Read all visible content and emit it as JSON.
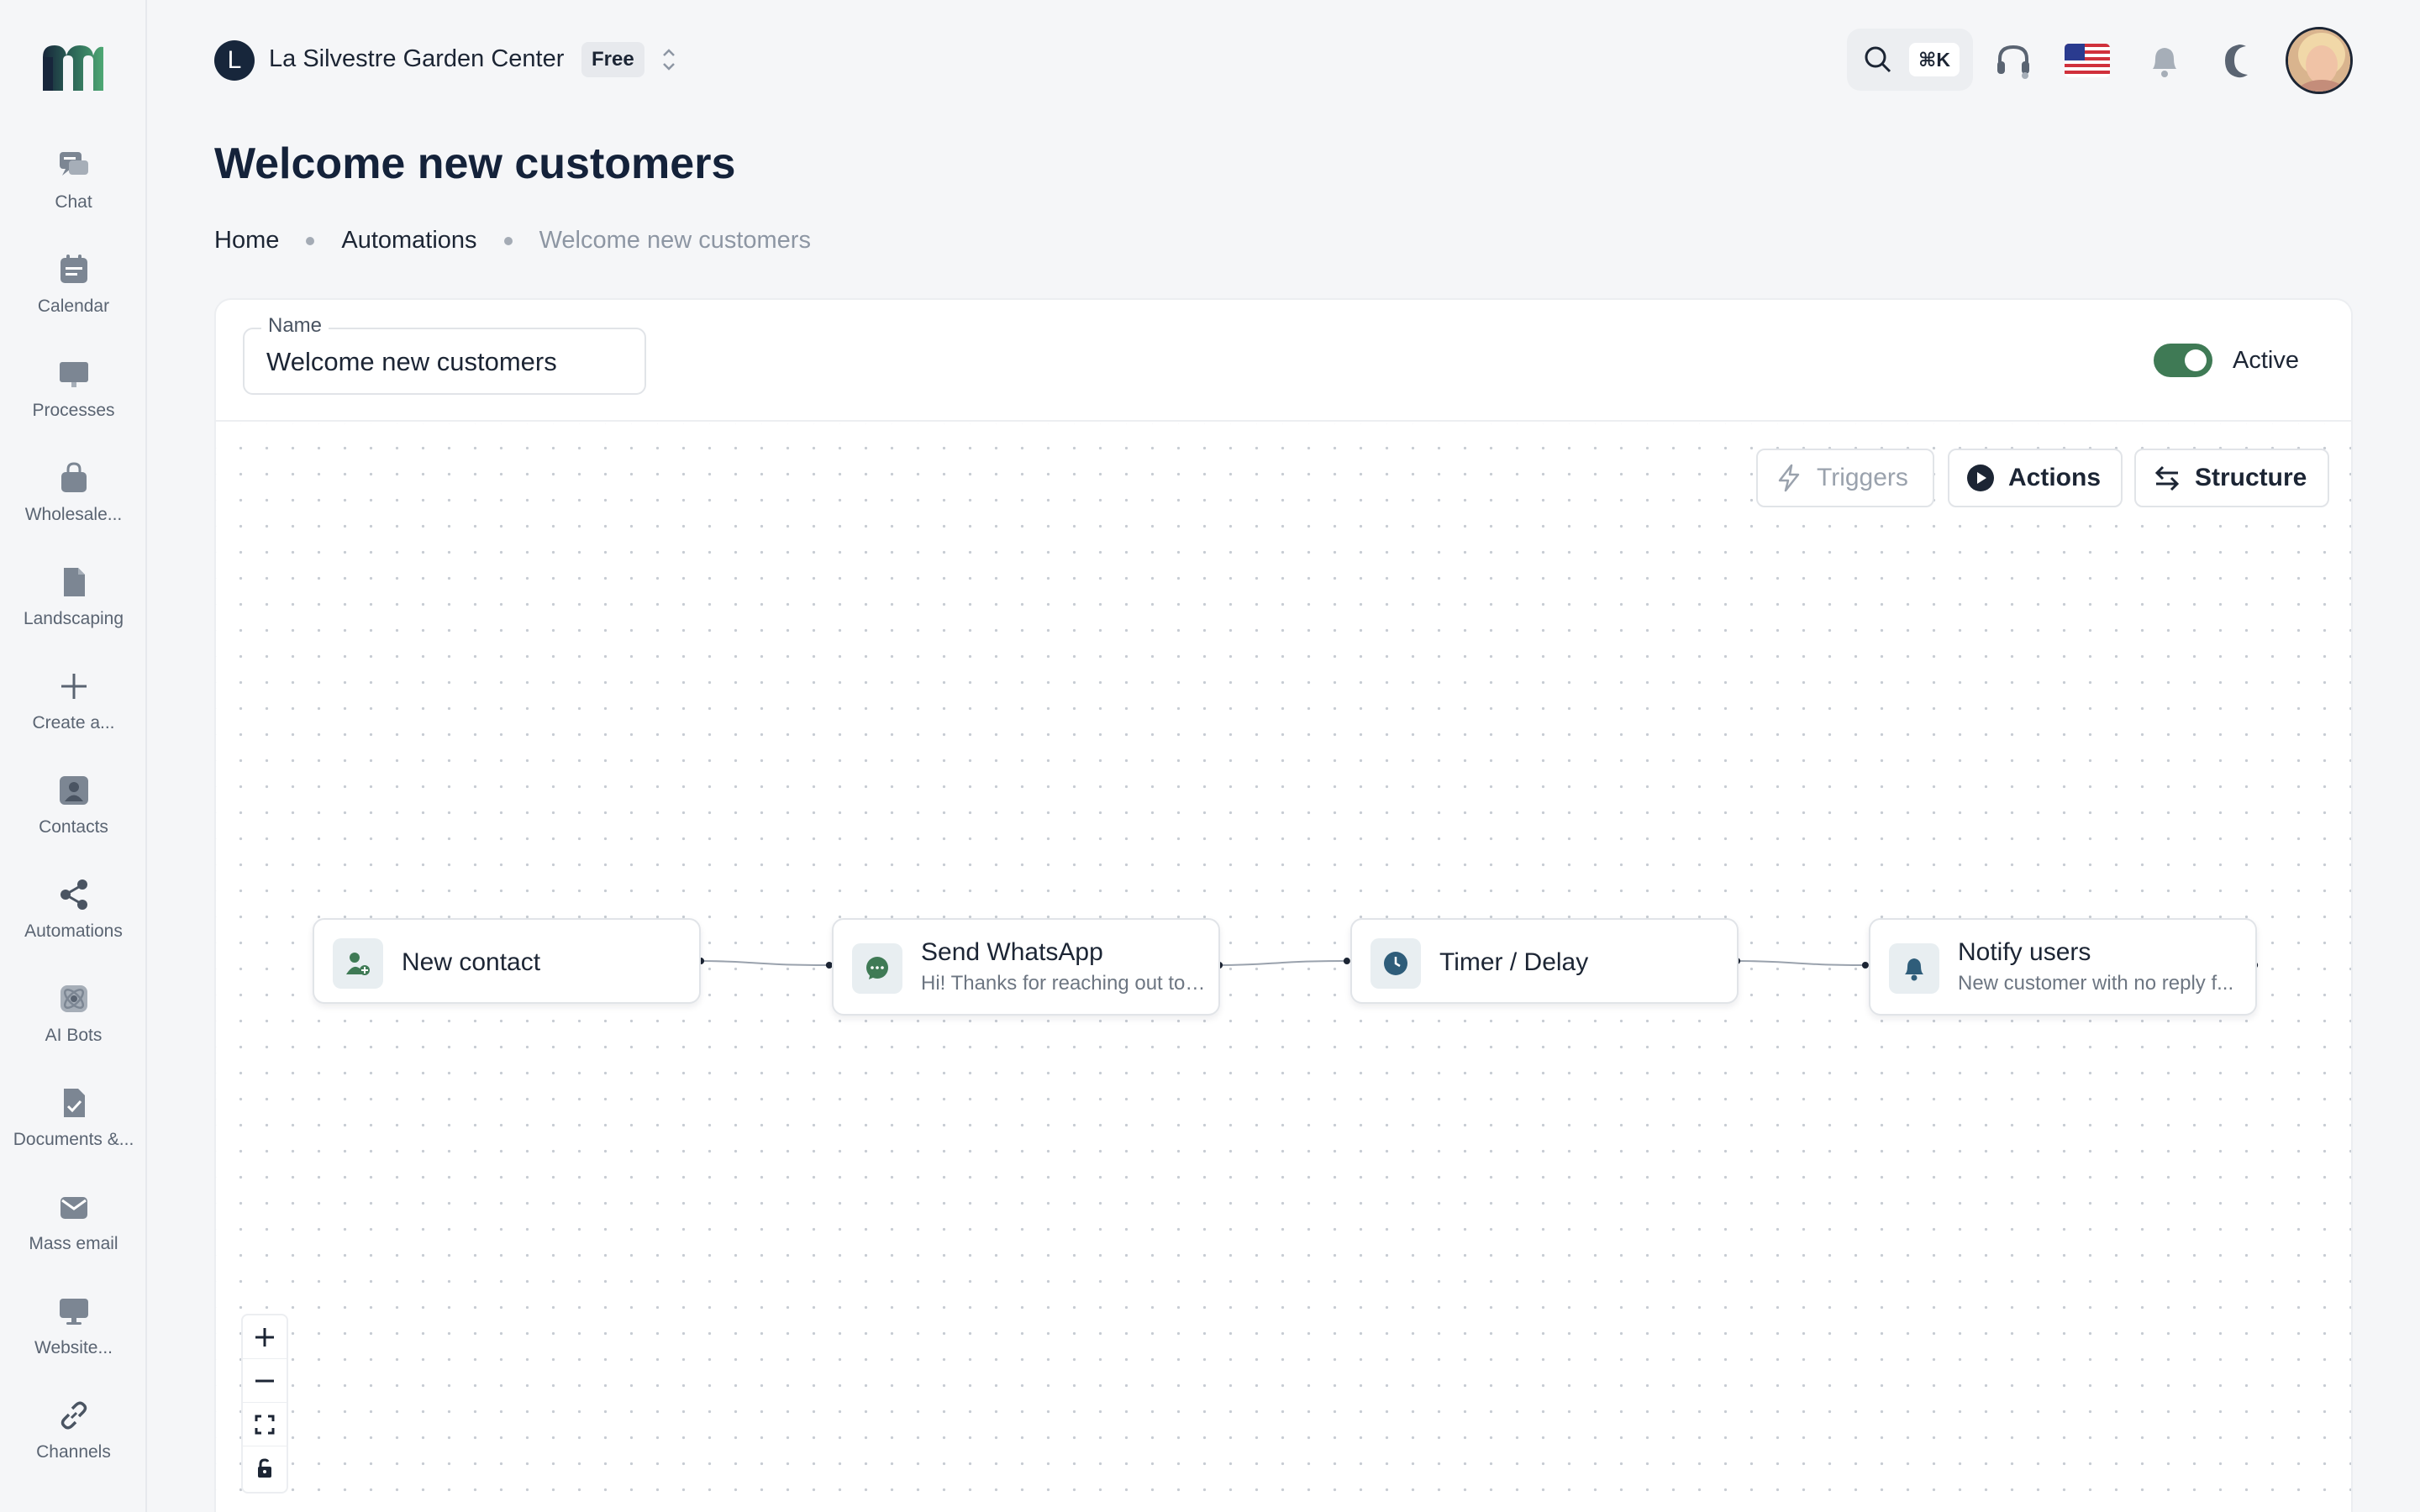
{
  "sidebar": {
    "items": [
      {
        "label": "Chat",
        "icon": "chat-icon"
      },
      {
        "label": "Calendar",
        "icon": "calendar-icon"
      },
      {
        "label": "Processes",
        "icon": "board-icon"
      },
      {
        "label": "Wholesale...",
        "icon": "shopping-bag-icon"
      },
      {
        "label": "Landscaping",
        "icon": "file-icon"
      },
      {
        "label": "Create a...",
        "icon": "plus-icon"
      },
      {
        "label": "Contacts",
        "icon": "contact-icon"
      },
      {
        "label": "Automations",
        "icon": "share-nodes-icon"
      },
      {
        "label": "AI Bots",
        "icon": "atom-icon"
      },
      {
        "label": "Documents &...",
        "icon": "document-check-icon"
      },
      {
        "label": "Mass email",
        "icon": "mail-icon"
      },
      {
        "label": "Website...",
        "icon": "monitor-icon"
      },
      {
        "label": "Channels",
        "icon": "link-icon"
      }
    ]
  },
  "header": {
    "org_initial": "L",
    "org_name": "La Silvestre Garden Center",
    "plan": "Free",
    "shortcut": "⌘K"
  },
  "page": {
    "title": "Welcome new customers",
    "breadcrumb": [
      "Home",
      "Automations",
      "Welcome new customers"
    ]
  },
  "form": {
    "name_label": "Name",
    "name_value": "Welcome new customers",
    "active_label": "Active",
    "active": true
  },
  "toolbar": {
    "triggers": "Triggers",
    "actions": "Actions",
    "structure": "Structure"
  },
  "flow": {
    "nodes": [
      {
        "title": "New contact",
        "subtitle": "",
        "icon": "contact-plus-icon"
      },
      {
        "title": "Send WhatsApp",
        "subtitle": "Hi! Thanks for reaching out to ...",
        "icon": "whatsapp-icon"
      },
      {
        "title": "Timer / Delay",
        "subtitle": "",
        "icon": "clock-icon"
      },
      {
        "title": "Notify users",
        "subtitle": "New customer with no reply f...",
        "icon": "bell-icon"
      }
    ]
  },
  "colors": {
    "accent": "#3f7a55",
    "navy": "#17263b",
    "icon_gray": "#7c8693"
  }
}
